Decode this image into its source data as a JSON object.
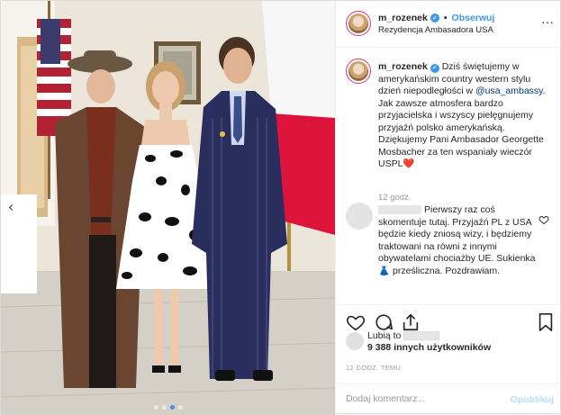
{
  "post": {
    "username": "m_rozenek",
    "verified_mark": "✓",
    "separator": "•",
    "follow_label": "Obserwuj",
    "location": "Rezydencja Ambasadora USA",
    "more_icon": "more-horizontal-icon",
    "more_label": "···"
  },
  "caption": {
    "username": "m_rozenek",
    "text_before": "Dziś świętujemy w amerykańskim country western stylu dzień niepodległości w ",
    "mention": "@usa_ambassy",
    "text_after": ". Jak zawsze atmosfera bardzo przyjacielska i wszyscy pielęgnujemy przyjaźń polsko amerykańską. Dziękujemy Pani Ambasador Georgette Mosbacher za ten wspaniały wieczór ",
    "emoji_text": "USPL❤️",
    "time": "12 godz."
  },
  "comment": {
    "text": "Pierwszy raz coś skomentuje tutaj. Przyjaźń PL z USA będzie kiedy zniosą wizy, i będziemy traktowani na równi z innymi obywatelami chociażby UE. Sukienka 👗 prześliczna. Pozdrawiam."
  },
  "likes": {
    "prefix": "Lubią to",
    "others": "9 388 innych użytkowników"
  },
  "timestamp": "12 GODZ. TEMU",
  "add_comment": {
    "placeholder": "Dodaj komentarz...",
    "publish_label": "Opublikuj"
  },
  "colors": {
    "accent": "#3897f0",
    "mention": "#003569",
    "heart": "#ed4956",
    "publish_disabled": "#b2dffc"
  }
}
